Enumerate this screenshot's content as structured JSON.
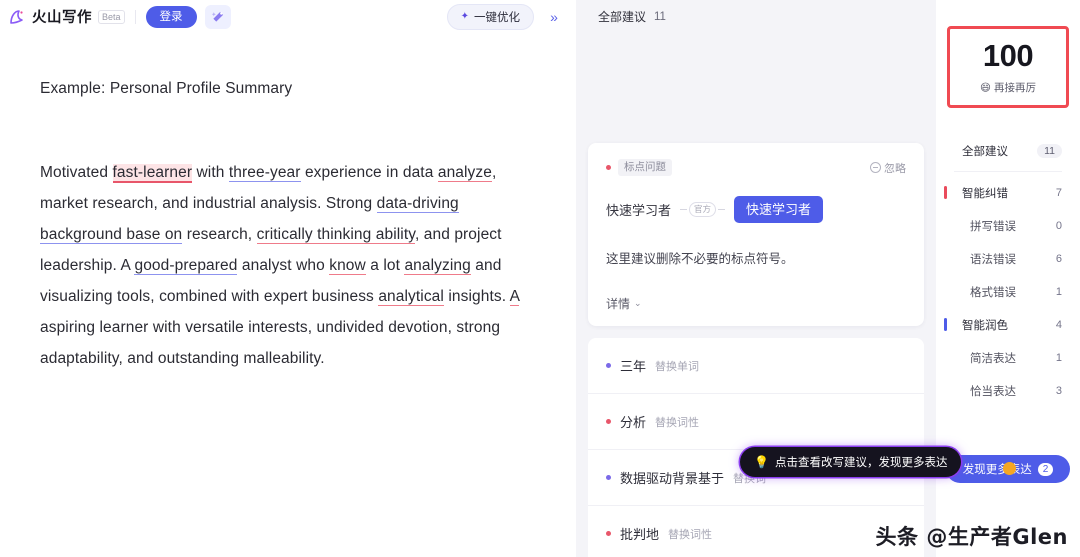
{
  "topbar": {
    "brand_name": "火山写作",
    "beta_label": "Beta",
    "login_label": "登录",
    "magic_icon": "magic-wand-icon",
    "optimize_label": "一键优化",
    "optimize_icon": "sparkle-icon",
    "collapse_icon": "chevron-double-right-icon"
  },
  "editor": {
    "title": "Example: Personal Profile Summary",
    "paragraph_parts": [
      {
        "t": "Motivated ",
        "mark": "none"
      },
      {
        "t": "fast-learner",
        "mark": "red-highlight"
      },
      {
        "t": " with ",
        "mark": "none"
      },
      {
        "t": "three-year",
        "mark": "blue-underline"
      },
      {
        "t": " experience in data ",
        "mark": "none"
      },
      {
        "t": "analyze",
        "mark": "red-underline"
      },
      {
        "t": ", market research, and industrial analysis. Strong ",
        "mark": "none"
      },
      {
        "t": "data-driving background base on",
        "mark": "blue-underline"
      },
      {
        "t": " research, ",
        "mark": "none"
      },
      {
        "t": "critically thinking ability",
        "mark": "red-underline"
      },
      {
        "t": ", and project leadership. A ",
        "mark": "none"
      },
      {
        "t": "good-prepared",
        "mark": "blue-underline"
      },
      {
        "t": " analyst who ",
        "mark": "none"
      },
      {
        "t": "know",
        "mark": "red-underline"
      },
      {
        "t": " a lot ",
        "mark": "none"
      },
      {
        "t": "analyzing",
        "mark": "red-underline"
      },
      {
        "t": " and visualizing tools, combined with expert business ",
        "mark": "none"
      },
      {
        "t": "analytical",
        "mark": "red-underline"
      },
      {
        "t": " insights. ",
        "mark": "none"
      },
      {
        "t": "A",
        "mark": "red-underline"
      },
      {
        "t": " aspiring learner with versatile interests, undivided devotion, strong adaptability, and outstanding malleability.",
        "mark": "none"
      }
    ]
  },
  "middle": {
    "header_label": "全部建议",
    "header_count": "11",
    "card": {
      "tag": "标点问题",
      "ignore_label": "忽略",
      "ignore_icon": "minus-circle-icon",
      "original": "快速学习者",
      "mini_chip": "官方",
      "suggestion": "快速学习者",
      "description": "这里建议删除不必要的标点符号。",
      "detail_label": "详情",
      "detail_icon": "chevron-down-icon"
    },
    "rows": [
      {
        "label": "三年",
        "action": "替换单词",
        "dot": "purple"
      },
      {
        "label": "分析",
        "action": "替换词性",
        "dot": "pink"
      },
      {
        "label": "数据驱动背景基于",
        "action": "替换词",
        "dot": "purple"
      },
      {
        "label": "批判地",
        "action": "替换词性",
        "dot": "pink"
      }
    ]
  },
  "sidebar": {
    "score": "100",
    "score_sub": "再接再厉",
    "score_emoji": "😄",
    "items": [
      {
        "label": "全部建议",
        "count": "11",
        "style": "pill",
        "indent": "group",
        "bar": "none"
      },
      {
        "label": "智能纠错",
        "count": "7",
        "style": "plain",
        "indent": "group",
        "bar": "red"
      },
      {
        "label": "拼写错误",
        "count": "0",
        "style": "plain",
        "indent": "sub",
        "bar": "none"
      },
      {
        "label": "语法错误",
        "count": "6",
        "style": "plain",
        "indent": "sub",
        "bar": "none"
      },
      {
        "label": "格式错误",
        "count": "1",
        "style": "plain",
        "indent": "sub",
        "bar": "none"
      },
      {
        "label": "智能润色",
        "count": "4",
        "style": "plain",
        "indent": "group",
        "bar": "blue"
      },
      {
        "label": "简洁表达",
        "count": "1",
        "style": "plain",
        "indent": "sub",
        "bar": "none"
      },
      {
        "label": "恰当表达",
        "count": "3",
        "style": "plain",
        "indent": "sub",
        "bar": "none"
      }
    ],
    "more_button_label": "发现更多表达",
    "more_button_count": "2"
  },
  "tooltip": {
    "icon": "lightbulb-icon",
    "text": "点击查看改写建议，发现更多表达"
  },
  "watermark": {
    "text": "头条 @生产者Glen"
  },
  "colors": {
    "brand_purple": "#4e5ce8",
    "error_red": "#e8566a",
    "polish_purple": "#7b6ae8",
    "score_border": "#f04a52",
    "tooltip_glow": "#8b3df0"
  }
}
